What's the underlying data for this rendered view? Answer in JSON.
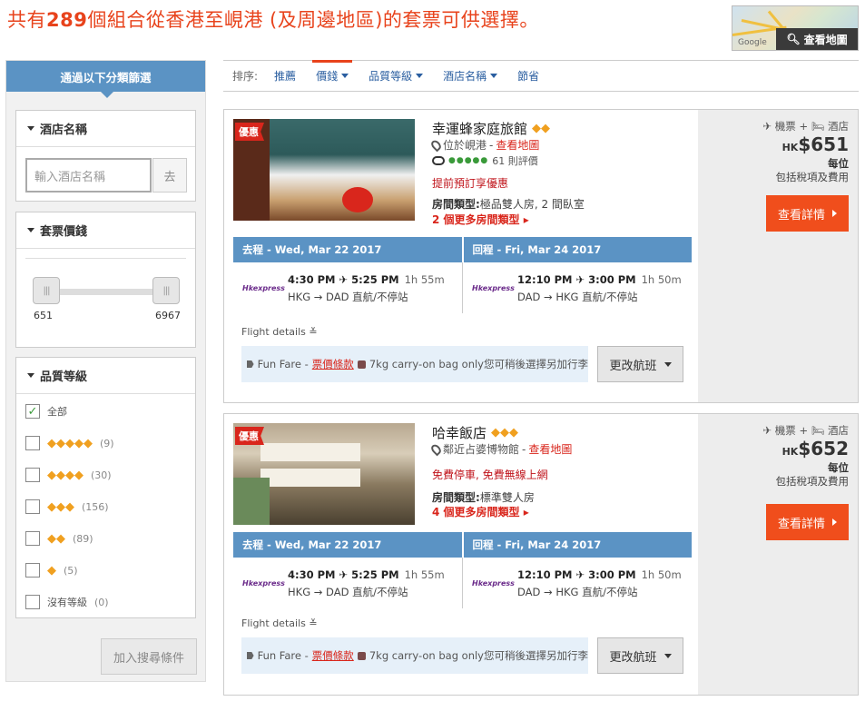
{
  "header": {
    "prefix": "共有",
    "count": "289",
    "suffix": "個組合從香港至峴港 (及周邊地區)的套票可供選擇。",
    "map_button": "查看地圖",
    "map_watermark": "Google"
  },
  "sidebar": {
    "title": "通過以下分類篩選",
    "hotel_name": {
      "title": "酒店名稱",
      "placeholder": "輸入酒店名稱",
      "go": "去"
    },
    "price": {
      "title": "套票價錢",
      "min": "651",
      "max": "6967"
    },
    "quality": {
      "title": "品質等級",
      "options": [
        {
          "label": "全部",
          "diamonds": "",
          "count": "",
          "checked": true
        },
        {
          "label": "",
          "diamonds": "◆◆◆◆◆",
          "count": "(9)",
          "checked": false
        },
        {
          "label": "",
          "diamonds": "◆◆◆◆",
          "count": "(30)",
          "checked": false
        },
        {
          "label": "",
          "diamonds": "◆◆◆",
          "count": "(156)",
          "checked": false
        },
        {
          "label": "",
          "diamonds": "◆◆",
          "count": "(89)",
          "checked": false
        },
        {
          "label": "",
          "diamonds": "◆",
          "count": "(5)",
          "checked": false
        },
        {
          "label": "沒有等級",
          "diamonds": "",
          "count": "(0)",
          "checked": false
        }
      ]
    },
    "add_button": "加入搜尋條件"
  },
  "sort": {
    "label": "排序:",
    "items": [
      "推薦",
      "價錢",
      "品質等級",
      "酒店名稱",
      "節省"
    ]
  },
  "results": [
    {
      "promo": "優惠",
      "name": "幸運蜂家庭旅館",
      "diamonds": "◆◆",
      "location": "位於峴港",
      "map_link": "查看地圖",
      "reviews": "61 則評價",
      "perk": "提前預訂享優惠",
      "room_label": "房間類型:",
      "room_value": "極品雙人房, 2 間臥室",
      "more_rooms": "2 個更多房間類型",
      "outbound_label": "去程 - Wed, Mar 22 2017",
      "return_label": "回程 - Fri, Mar 24 2017",
      "out_times": "4:30 PM ✈ 5:25 PM",
      "out_duration": "1h 55m",
      "out_route": "HKG → DAD   直航/不停站",
      "ret_times": "12:10 PM ✈ 3:00 PM",
      "ret_duration": "1h 50m",
      "ret_route": "DAD → HKG   直航/不停站",
      "flight_details": "Flight details ≚",
      "fare_name": "Fun Fare -",
      "fare_link": "票價條款",
      "bag_text": "7kg carry-on bag only您可稍後選擇另加行李",
      "change_flight": "更改航班",
      "package": "✈ 機票 + 🛏 酒店",
      "currency": "HK",
      "price": "$651",
      "per": "每位",
      "tax": "包括稅項及費用",
      "details_button": "查看詳情"
    },
    {
      "promo": "優惠",
      "name": "哈幸飯店",
      "diamonds": "◆◆◆",
      "location": "鄰近占婆博物館",
      "map_link": "查看地圖",
      "reviews": "",
      "perk": "免費停車, 免費無線上網",
      "room_label": "房間類型:",
      "room_value": "標準雙人房",
      "more_rooms": "4 個更多房間類型",
      "outbound_label": "去程 - Wed, Mar 22 2017",
      "return_label": "回程 - Fri, Mar 24 2017",
      "out_times": "4:30 PM ✈ 5:25 PM",
      "out_duration": "1h 55m",
      "out_route": "HKG → DAD   直航/不停站",
      "ret_times": "12:10 PM ✈ 3:00 PM",
      "ret_duration": "1h 50m",
      "ret_route": "DAD → HKG   直航/不停站",
      "flight_details": "Flight details ≚",
      "fare_name": "Fun Fare -",
      "fare_link": "票價條款",
      "bag_text": "7kg carry-on bag only您可稍後選擇另加行李",
      "change_flight": "更改航班",
      "package": "✈ 機票 + 🛏 酒店",
      "currency": "HK",
      "price": "$652",
      "per": "每位",
      "tax": "包括稅項及費用",
      "details_button": "查看詳情"
    }
  ],
  "airline": {
    "hk": "Hk",
    "express": "express"
  }
}
